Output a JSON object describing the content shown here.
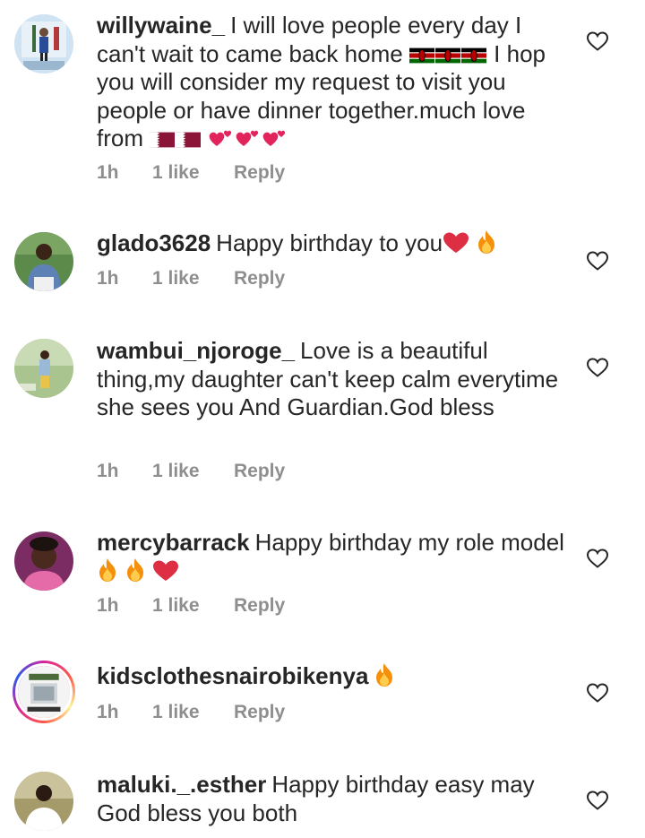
{
  "comments": [
    {
      "username": "willywaine_",
      "text_parts": [
        "I will love people every day I can't wait to came back home",
        "I hop you will consider my request to visit you people or have dinner together.much love from"
      ],
      "emoji": [
        "kenya-flag",
        "kenya-flag",
        "kenya-flag",
        "qatar-flag",
        "qatar-flag",
        "two-hearts",
        "two-hearts",
        "two-hearts"
      ],
      "time": "1h",
      "likes": "1 like",
      "reply": "Reply"
    },
    {
      "username": "glado3628",
      "text": "Happy birthday to you",
      "emoji": [
        "red-heart",
        "fire"
      ],
      "time": "1h",
      "likes": "1 like",
      "reply": "Reply"
    },
    {
      "username": "wambui_njoroge_",
      "text": "Love is a beautiful thing,my daughter  can't keep calm everytime she sees you And Guardian.God bless",
      "time": "1h",
      "likes": "1 like",
      "reply": "Reply"
    },
    {
      "username": "mercybarrack",
      "text": "Happy birthday my role model",
      "emoji": [
        "fire",
        "fire",
        "red-heart"
      ],
      "time": "1h",
      "likes": "1 like",
      "reply": "Reply"
    },
    {
      "username": "kidsclothesnairobikenya",
      "text": "",
      "emoji": [
        "fire"
      ],
      "time": "1h",
      "likes": "1 like",
      "reply": "Reply"
    },
    {
      "username": "maluki._.esther",
      "text": "Happy birthday easy may God bless you both"
    }
  ]
}
